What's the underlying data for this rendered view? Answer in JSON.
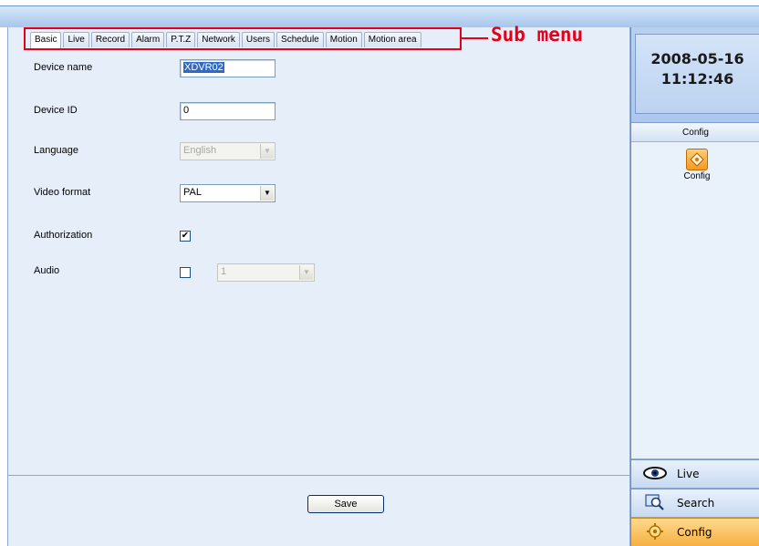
{
  "tabs": [
    "Basic",
    "Live",
    "Record",
    "Alarm",
    "P.T.Z",
    "Network",
    "Users",
    "Schedule",
    "Motion",
    "Motion area"
  ],
  "annotation": {
    "label": "Sub menu",
    "color": "#e3001b"
  },
  "form": {
    "device_name": {
      "label": "Device name",
      "value": "XDVR02"
    },
    "device_id": {
      "label": "Device ID",
      "value": "0"
    },
    "language": {
      "label": "Language",
      "value": "English"
    },
    "video_format": {
      "label": "Video format",
      "value": "PAL"
    },
    "authorization": {
      "label": "Authorization",
      "checked": true
    },
    "audio": {
      "label": "Audio",
      "checked": false,
      "channel": "1"
    }
  },
  "save_label": "Save",
  "sidebar": {
    "date": "2008-05-16",
    "time": "11:12:46",
    "panel_title": "Config",
    "panel_item": "Config",
    "nav": [
      {
        "label": "Live",
        "icon": "eye-icon"
      },
      {
        "label": "Search",
        "icon": "magnifier-icon"
      },
      {
        "label": "Config",
        "icon": "gear-icon",
        "active": true
      }
    ]
  }
}
